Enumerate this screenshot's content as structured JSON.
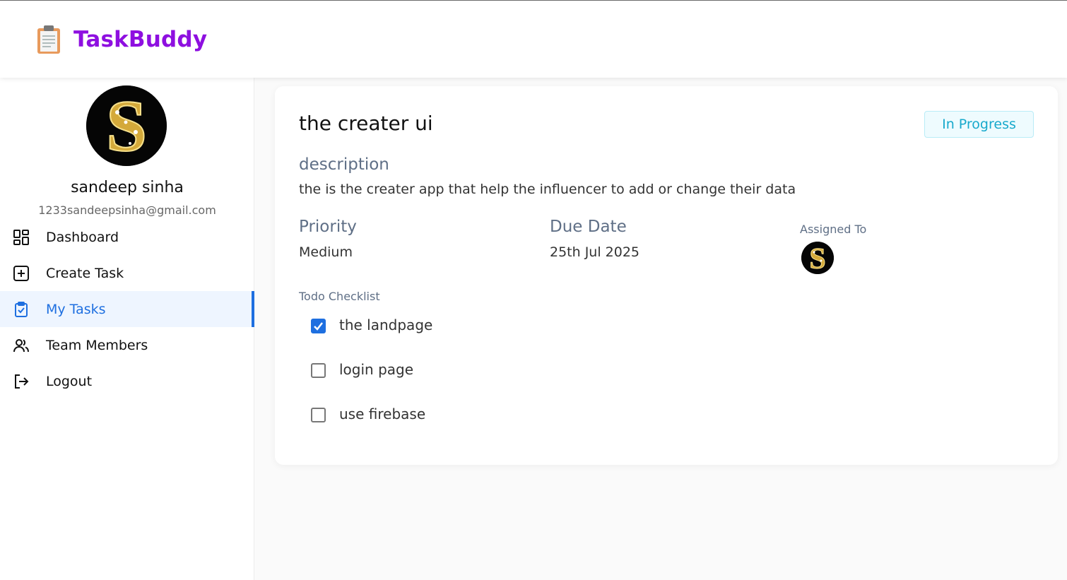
{
  "app": {
    "brand": "TaskBuddy",
    "logo_icon": "clipboard-icon",
    "brand_color": "#8e0fe0",
    "accent_color": "#1e6fe0"
  },
  "user": {
    "name": "sandeep sinha",
    "email": "1233sandeepsinha@gmail.com",
    "avatar_icon": "avatar-letter-s"
  },
  "sidebar": {
    "items": [
      {
        "label": "Dashboard",
        "icon": "dashboard-icon",
        "active": false
      },
      {
        "label": "Create Task",
        "icon": "plus-square-icon",
        "active": false
      },
      {
        "label": "My Tasks",
        "icon": "clipboard-check-icon",
        "active": true
      },
      {
        "label": "Team Members",
        "icon": "users-icon",
        "active": false
      },
      {
        "label": "Logout",
        "icon": "logout-icon",
        "active": false
      }
    ]
  },
  "task": {
    "title": "the creater ui",
    "status": "In Progress",
    "status_color": "#17a9cc",
    "description_label": "description",
    "description": "the is the creater app that help the influencer to add or change their data",
    "priority_label": "Priority",
    "priority": "Medium",
    "due_label": "Due Date",
    "due_date": "25th Jul 2025",
    "assigned_label": "Assigned To",
    "checklist_label": "Todo Checklist",
    "checklist": [
      {
        "text": "the landpage",
        "checked": true
      },
      {
        "text": "login page",
        "checked": false
      },
      {
        "text": "use firebase",
        "checked": false
      }
    ]
  }
}
